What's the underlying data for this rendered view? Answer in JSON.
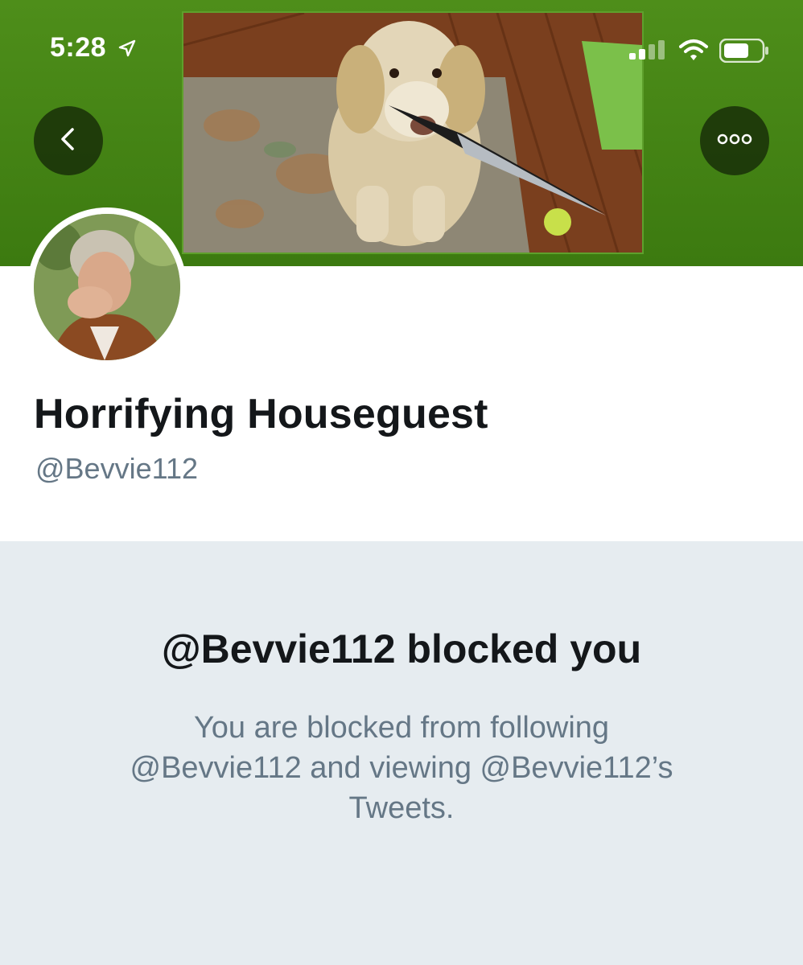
{
  "status_bar": {
    "time": "5:28",
    "icons": [
      "location-arrow-icon",
      "cellular-signal-icon",
      "wifi-icon",
      "battery-icon"
    ]
  },
  "nav": {
    "back_icon": "chevron-left-icon",
    "more_icon": "more-horizontal-icon"
  },
  "colors": {
    "header_green": "#3c7a10",
    "text_primary": "#14171a",
    "text_secondary": "#657786",
    "body_bg": "#e6ecf0"
  },
  "profile": {
    "display_name": "Horrifying Houseguest",
    "handle": "@Bevvie112"
  },
  "blocked": {
    "title": "@Bevvie112 blocked you",
    "line1": "You are blocked from following",
    "line2": "@Bevvie112 and viewing @Bevvie112’s",
    "line3": "Tweets."
  }
}
